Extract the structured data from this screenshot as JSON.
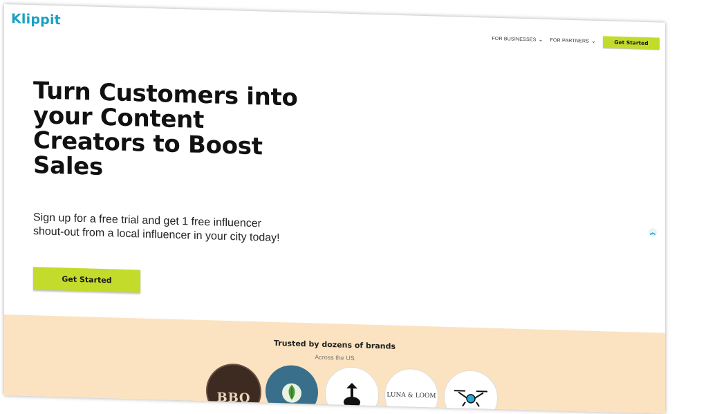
{
  "logo": "Klippit",
  "nav": {
    "items": [
      "FOR BUSINESSES",
      "FOR PARTNERS"
    ],
    "button": "Get Started"
  },
  "hero": {
    "title": "Turn Customers into your Content Creators to Boost Sales",
    "subtitle": "Sign up for a free trial and get 1 free influencer shout-out from a local influencer in your city today!",
    "button": "Get Started"
  },
  "trusted": {
    "title": "Trusted by dozens of brands",
    "subtitle": "Across the US",
    "brands": [
      "BBQ",
      "",
      "",
      "LUNA & LOOM",
      ""
    ]
  },
  "colors": {
    "brand": "#1aa0c4",
    "accent": "#c3db2b",
    "section_bg": "#fbe3c1"
  },
  "icons": {
    "chevron": "chevron-down-icon",
    "scroll_top": "double-chevron-up-icon"
  }
}
